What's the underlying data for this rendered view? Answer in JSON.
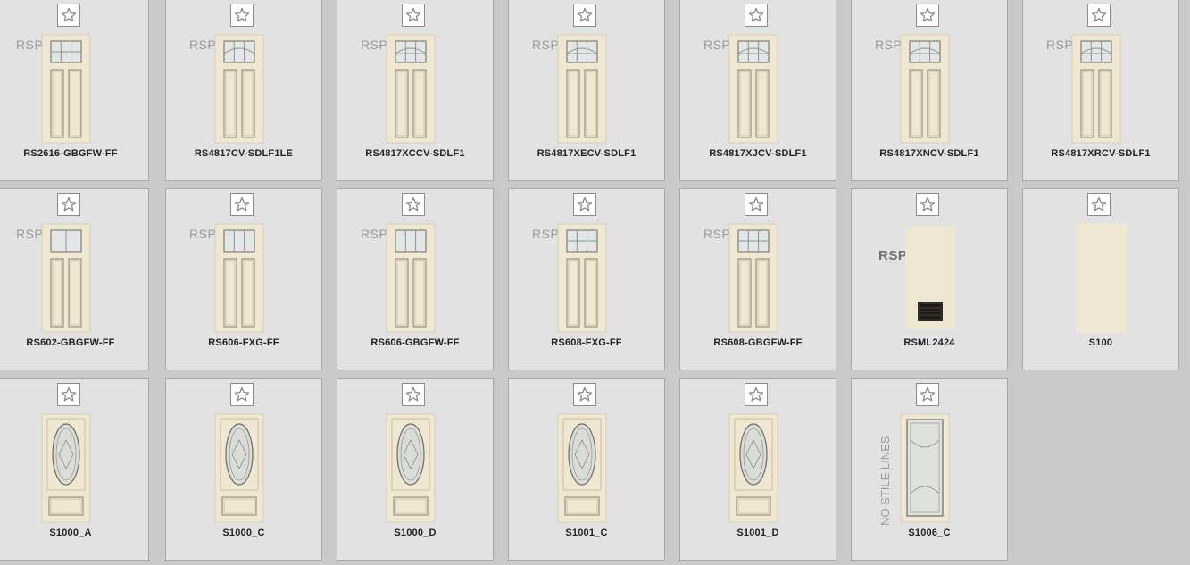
{
  "colors": {
    "door": "#efe7d2",
    "door_edge": "#d9cfb4",
    "glass": "#e3e6e6"
  },
  "rows": [
    {
      "items": [
        {
          "label": "RS2616-GBGFW-FF",
          "rsp": "RSP",
          "type": "transom",
          "glass": "grid6"
        },
        {
          "label": "RS4817CV-SDLF1LE",
          "rsp": "RSP",
          "type": "transom",
          "glass": "arch"
        },
        {
          "label": "RS4817XCCV-SDLF1",
          "rsp": "RSP",
          "type": "transom",
          "glass": "arch2"
        },
        {
          "label": "RS4817XECV-SDLF1",
          "rsp": "RSP",
          "type": "transom",
          "glass": "arch3"
        },
        {
          "label": "RS4817XJCV-SDLF1",
          "rsp": "RSP",
          "type": "transom",
          "glass": "arch4"
        },
        {
          "label": "RS4817XNCV-SDLF1",
          "rsp": "RSP",
          "type": "transom",
          "glass": "arch5"
        },
        {
          "label": "RS4817XRCV-SDLF1",
          "rsp": "RSP",
          "type": "transom",
          "glass": "arch6"
        }
      ]
    },
    {
      "items": [
        {
          "label": "RS602-GBGFW-FF",
          "rsp": "RSP",
          "type": "transom",
          "glass": "grid2"
        },
        {
          "label": "RS606-FXG-FF",
          "rsp": "RSP",
          "type": "transom",
          "glass": "grid3"
        },
        {
          "label": "RS606-GBGFW-FF",
          "rsp": "RSP",
          "type": "transom",
          "glass": "grid3b"
        },
        {
          "label": "RS608-FXG-FF",
          "rsp": "RSP",
          "type": "transom",
          "glass": "grid8"
        },
        {
          "label": "RS608-GBGFW-FF",
          "rsp": "RSP",
          "type": "transom",
          "glass": "grid8b"
        },
        {
          "label": "RSML2424",
          "rsp": "RSP",
          "type": "mail"
        },
        {
          "label": "S100",
          "rsp": "",
          "type": "flush"
        }
      ]
    },
    {
      "items": [
        {
          "label": "S1000_A",
          "type": "oval",
          "glass": "a"
        },
        {
          "label": "S1000_C",
          "type": "oval",
          "glass": "c"
        },
        {
          "label": "S1000_D",
          "type": "oval",
          "glass": "d"
        },
        {
          "label": "S1001_C",
          "type": "oval",
          "glass": "c2"
        },
        {
          "label": "S1001_D",
          "type": "oval",
          "glass": "d2"
        },
        {
          "label": "S1006_C",
          "type": "full",
          "stile": "NO STILE LINES"
        }
      ]
    }
  ]
}
